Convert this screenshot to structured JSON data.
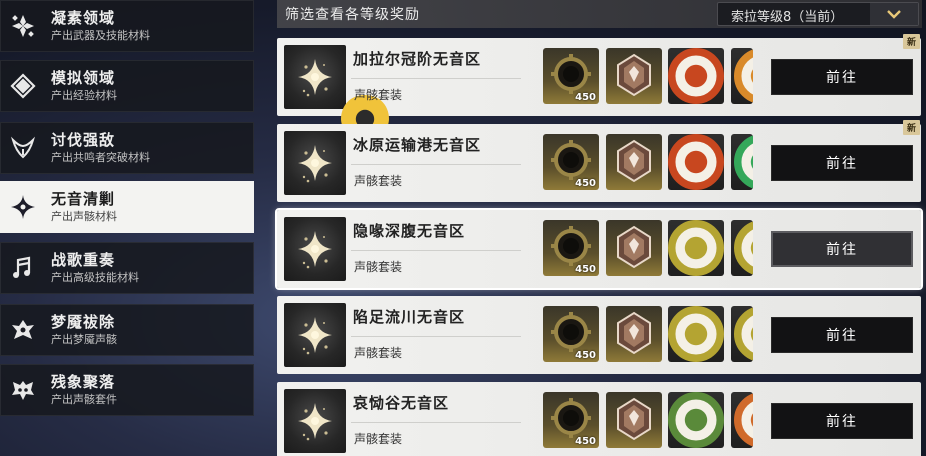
{
  "sidebar": {
    "items": [
      {
        "title": "凝素领域",
        "subtitle": "产出武器及技能材料",
        "icon": "crystal-cluster-icon",
        "active": false
      },
      {
        "title": "模拟领域",
        "subtitle": "产出经验材料",
        "icon": "diamond-rhombus-icon",
        "active": false
      },
      {
        "title": "讨伐强敌",
        "subtitle": "产出共鸣者突破材料",
        "icon": "horned-crest-icon",
        "active": false
      },
      {
        "title": "无音清剿",
        "subtitle": "产出声骸材料",
        "icon": "four-point-star-icon",
        "active": true
      },
      {
        "title": "战歌重奏",
        "subtitle": "产出高级技能材料",
        "icon": "music-note-icon",
        "active": false
      },
      {
        "title": "梦魇祓除",
        "subtitle": "产出梦魇声骸",
        "icon": "nightmare-mask-icon",
        "active": false
      },
      {
        "title": "残象聚落",
        "subtitle": "产出声骸套件",
        "icon": "winged-mask-icon",
        "active": false
      }
    ]
  },
  "header": {
    "title": "筛选查看各等级奖励",
    "level_select": "索拉等级8（当前）",
    "dropdown_icon": "chevron-down-icon"
  },
  "cards": [
    {
      "title": "加拉尔冠阶无音区",
      "subtitle": "声骸套装",
      "button": "前往",
      "is_new": true,
      "new_label": "新",
      "has_location": true,
      "rewards": [
        {
          "type": "ring",
          "count": "450"
        },
        {
          "type": "gem"
        },
        {
          "type": "spark",
          "badge": "#c8471f"
        },
        {
          "type": "partial",
          "badge": "#d98a2a"
        }
      ]
    },
    {
      "title": "冰原运输港无音区",
      "subtitle": "声骸套装",
      "button": "前往",
      "is_new": true,
      "new_label": "新",
      "has_location": false,
      "rewards": [
        {
          "type": "ring",
          "count": "450"
        },
        {
          "type": "gem"
        },
        {
          "type": "spark",
          "badge": "#c8471f"
        },
        {
          "type": "partial",
          "badge": "#35a85a"
        }
      ]
    },
    {
      "title": "隐喙深腹无音区",
      "subtitle": "声骸套装",
      "button": "前往",
      "is_new": false,
      "new_label": "",
      "has_location": false,
      "selected": true,
      "rewards": [
        {
          "type": "ring",
          "count": "450"
        },
        {
          "type": "gem"
        },
        {
          "type": "spark",
          "badge": "#b4a432"
        },
        {
          "type": "partial",
          "badge": "#b4a432"
        }
      ]
    },
    {
      "title": "陷足流川无音区",
      "subtitle": "声骸套装",
      "button": "前往",
      "is_new": false,
      "new_label": "",
      "has_location": false,
      "rewards": [
        {
          "type": "ring",
          "count": "450"
        },
        {
          "type": "gem"
        },
        {
          "type": "spark",
          "badge": "#b4a432"
        },
        {
          "type": "partial",
          "badge": "#b4a432"
        }
      ]
    },
    {
      "title": "哀恸谷无音区",
      "subtitle": "声骸套装",
      "button": "前往",
      "is_new": false,
      "new_label": "",
      "has_location": false,
      "rewards": [
        {
          "type": "ring",
          "count": "450"
        },
        {
          "type": "gem"
        },
        {
          "type": "spark",
          "badge": "#5a8a3a"
        },
        {
          "type": "partial",
          "badge": "#d06a2a"
        }
      ]
    }
  ],
  "colors": {
    "accent_gold": "#8f7a38",
    "button_dark": "#121214",
    "active_tab": "#f3f3f1"
  }
}
